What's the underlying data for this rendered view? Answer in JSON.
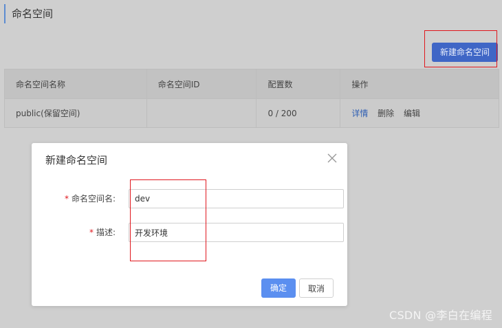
{
  "header": {
    "title": "命名空间"
  },
  "toolbar": {
    "new_button": "新建命名空间"
  },
  "table": {
    "columns": [
      "命名空间名称",
      "命名空间ID",
      "配置数",
      "操作"
    ],
    "rows": [
      {
        "name": "public(保留空间)",
        "id": "",
        "count": "0 / 200",
        "actions": [
          "详情",
          "删除",
          "编辑"
        ]
      }
    ]
  },
  "dialog": {
    "title": "新建命名空间",
    "name_label": "命名空间名:",
    "name_value": "dev",
    "desc_label": "描述:",
    "desc_value": "开发环境",
    "required_mark": "*",
    "ok_label": "确定",
    "cancel_label": "取消"
  },
  "watermark": "CSDN @李白在编程",
  "colors": {
    "accent": "#3f66c6",
    "ok_button": "#5b8ff0",
    "required": "#e0161c"
  }
}
